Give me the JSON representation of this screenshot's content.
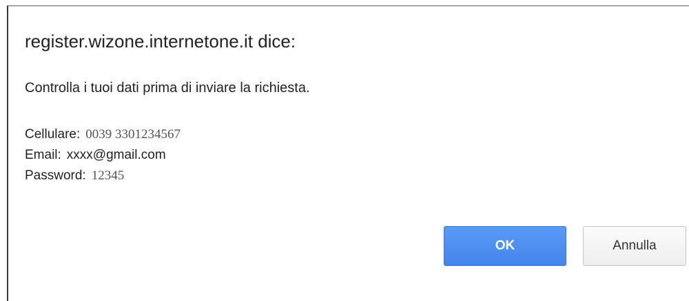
{
  "dialog": {
    "title": "register.wizone.internetone.it dice:",
    "message": "Controlla i tuoi dati prima di inviare la richiesta.",
    "fields": [
      {
        "label": "Cellulare:",
        "value": "0039 3301234567"
      },
      {
        "label": "Email:",
        "value": "xxxx@gmail.com"
      },
      {
        "label": "Password:",
        "value": "12345"
      }
    ],
    "buttons": {
      "ok_label": "OK",
      "cancel_label": "Annulla"
    }
  },
  "colors": {
    "ok_button": "#4a8af0",
    "cancel_button": "#f4f4f4",
    "text": "#222222"
  }
}
